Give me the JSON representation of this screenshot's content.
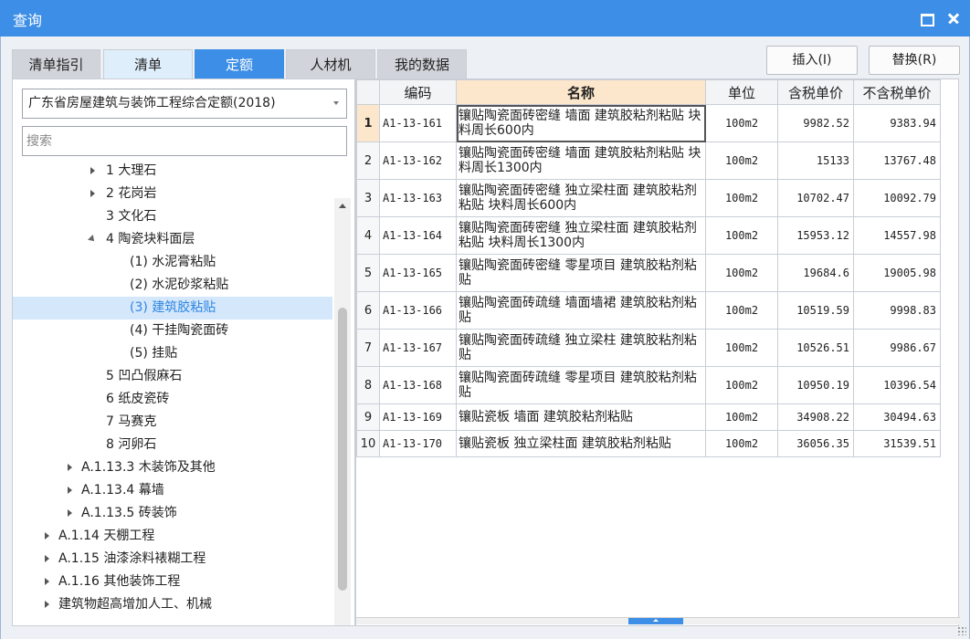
{
  "window": {
    "title": "查询"
  },
  "tabs": [
    "清单指引",
    "清单",
    "定额",
    "人材机",
    "我的数据"
  ],
  "active_tab": "定额",
  "toolbar": {
    "insert": "插入(I)",
    "replace": "替换(R)"
  },
  "library": {
    "selected": "广东省房屋建筑与装饰工程综合定额(2018)"
  },
  "search": {
    "placeholder": "搜索"
  },
  "tree": [
    {
      "label": "1 大理石",
      "level": 3,
      "toggle": "collapsed"
    },
    {
      "label": "2 花岗岩",
      "level": 3,
      "toggle": "collapsed"
    },
    {
      "label": "3 文化石",
      "level": 3,
      "toggle": "none"
    },
    {
      "label": "4 陶瓷块料面层",
      "level": 3,
      "toggle": "expanded"
    },
    {
      "label": "(1) 水泥膏粘贴",
      "level": 4,
      "toggle": "none"
    },
    {
      "label": "(2) 水泥砂浆粘贴",
      "level": 4,
      "toggle": "none"
    },
    {
      "label": "(3) 建筑胶粘贴",
      "level": 4,
      "toggle": "none",
      "selected": true
    },
    {
      "label": "(4) 干挂陶瓷面砖",
      "level": 4,
      "toggle": "none"
    },
    {
      "label": "(5) 挂贴",
      "level": 4,
      "toggle": "none"
    },
    {
      "label": "5 凹凸假麻石",
      "level": 3,
      "toggle": "none"
    },
    {
      "label": "6 纸皮瓷砖",
      "level": 3,
      "toggle": "none"
    },
    {
      "label": "7 马赛克",
      "level": 3,
      "toggle": "none"
    },
    {
      "label": "8 河卵石",
      "level": 3,
      "toggle": "none"
    },
    {
      "label": "A.1.13.3 木装饰及其他",
      "level": 2,
      "toggle": "collapsed"
    },
    {
      "label": "A.1.13.4 幕墙",
      "level": 2,
      "toggle": "collapsed"
    },
    {
      "label": "A.1.13.5 砖装饰",
      "level": 2,
      "toggle": "collapsed"
    },
    {
      "label": "A.1.14 天棚工程",
      "level": 1,
      "toggle": "collapsed"
    },
    {
      "label": "A.1.15 油漆涂料裱糊工程",
      "level": 1,
      "toggle": "collapsed"
    },
    {
      "label": "A.1.16 其他装饰工程",
      "level": 1,
      "toggle": "collapsed"
    },
    {
      "label": "建筑物超高增加人工、机械",
      "level": 1,
      "toggle": "collapsed"
    }
  ],
  "table": {
    "headers": {
      "code": "编码",
      "name": "名称",
      "unit": "单位",
      "tax": "含税单价",
      "notax": "不含税单价"
    },
    "rows": [
      {
        "index": "1",
        "code": "A1-13-161",
        "name": "镶贴陶瓷面砖密缝 墙面 建筑胶粘剂粘贴 块料周长600内",
        "unit": "100m2",
        "tax": "9982.52",
        "notax": "9383.94"
      },
      {
        "index": "2",
        "code": "A1-13-162",
        "name": "镶贴陶瓷面砖密缝 墙面 建筑胶粘剂粘贴 块料周长1300内",
        "unit": "100m2",
        "tax": "15133",
        "notax": "13767.48"
      },
      {
        "index": "3",
        "code": "A1-13-163",
        "name": "镶贴陶瓷面砖密缝 独立梁柱面 建筑胶粘剂粘贴 块料周长600内",
        "unit": "100m2",
        "tax": "10702.47",
        "notax": "10092.79"
      },
      {
        "index": "4",
        "code": "A1-13-164",
        "name": "镶贴陶瓷面砖密缝 独立梁柱面 建筑胶粘剂粘贴 块料周长1300内",
        "unit": "100m2",
        "tax": "15953.12",
        "notax": "14557.98"
      },
      {
        "index": "5",
        "code": "A1-13-165",
        "name": "镶贴陶瓷面砖密缝 零星项目 建筑胶粘剂粘贴",
        "unit": "100m2",
        "tax": "19684.6",
        "notax": "19005.98"
      },
      {
        "index": "6",
        "code": "A1-13-166",
        "name": "镶贴陶瓷面砖疏缝 墙面墙裙 建筑胶粘剂粘贴",
        "unit": "100m2",
        "tax": "10519.59",
        "notax": "9998.83"
      },
      {
        "index": "7",
        "code": "A1-13-167",
        "name": "镶贴陶瓷面砖疏缝 独立梁柱 建筑胶粘剂粘贴",
        "unit": "100m2",
        "tax": "10526.51",
        "notax": "9986.67"
      },
      {
        "index": "8",
        "code": "A1-13-168",
        "name": "镶贴陶瓷面砖疏缝 零星项目 建筑胶粘剂粘贴",
        "unit": "100m2",
        "tax": "10950.19",
        "notax": "10396.54"
      },
      {
        "index": "9",
        "code": "A1-13-169",
        "name": "镶贴瓷板 墙面 建筑胶粘剂粘贴",
        "unit": "100m2",
        "tax": "34908.22",
        "notax": "30494.63"
      },
      {
        "index": "10",
        "code": "A1-13-170",
        "name": "镶贴瓷板 独立梁柱面 建筑胶粘剂粘贴",
        "unit": "100m2",
        "tax": "36056.35",
        "notax": "31539.51"
      }
    ]
  },
  "colors": {
    "titlebar": "#3d8ee6",
    "selected_tree_text": "#2d86e2",
    "header_highlight": "#fde7cc"
  }
}
